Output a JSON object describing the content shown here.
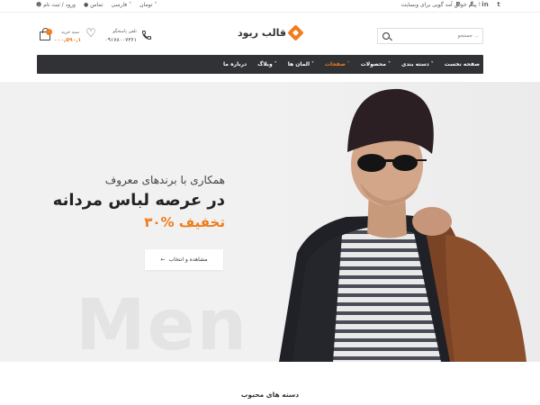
{
  "topbar": {
    "auth": "ورود / ثبت نام",
    "contact": "تماس",
    "language": "فارسی",
    "currency": "تومان",
    "welcome": "پیام خوش آمد گویی برای وبسایت !",
    "socials": [
      "twitter",
      "linkedin",
      "facebook",
      "pinterest"
    ]
  },
  "header": {
    "cart_badge": "۰",
    "cart_label": "سبد خرید",
    "cart_amount": "۰۰۰,۵۹۰,۱",
    "support_label": "تلفن پاسخگو",
    "support_phone": "۰۹۱۷۸۰۰۷۳۶۱",
    "logo_text": "قالب ریود",
    "search_placeholder": "جستجو ..."
  },
  "nav": {
    "items": [
      {
        "label": "صفحه نخست",
        "has_dropdown": false,
        "active": false
      },
      {
        "label": "دسته بندی",
        "has_dropdown": true,
        "active": false
      },
      {
        "label": "محصولات",
        "has_dropdown": true,
        "active": false
      },
      {
        "label": "صفحات",
        "has_dropdown": true,
        "active": true
      },
      {
        "label": "المان ها",
        "has_dropdown": true,
        "active": false
      },
      {
        "label": "وبلاگ",
        "has_dropdown": true,
        "active": false
      },
      {
        "label": "درباره ما",
        "has_dropdown": false,
        "active": false
      }
    ]
  },
  "hero": {
    "line1": "همکاری با برندهای معروف",
    "line2": "در عرصه لباس مردانه",
    "line3": "۳۰% تخفیف",
    "button": "مشاهده و انتخاب",
    "ghost_text": "Men"
  },
  "sections": {
    "popular_categories": "دسته های محبوب"
  },
  "colors": {
    "accent": "#f07c1b",
    "nav_bg": "#303236"
  }
}
